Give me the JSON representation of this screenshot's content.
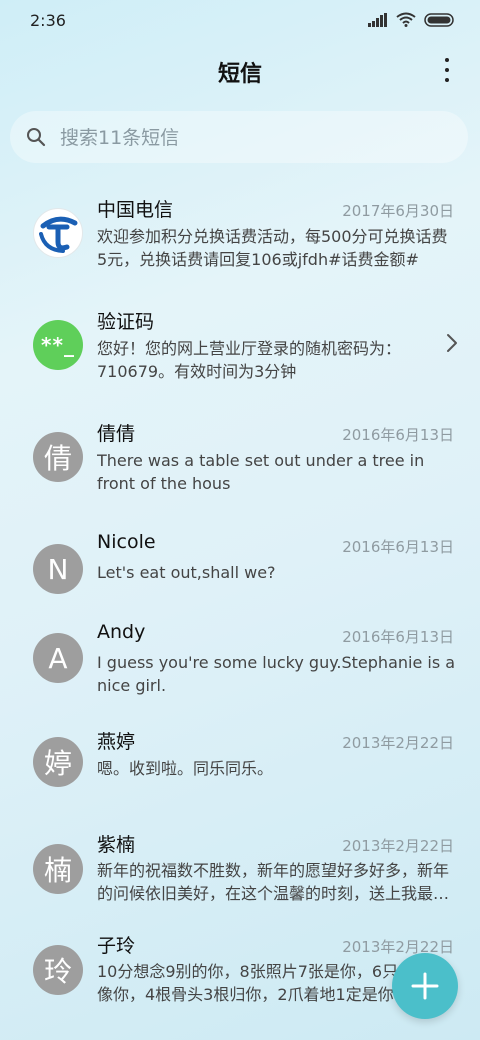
{
  "status_bar": {
    "time": "2:36",
    "icons": [
      "signal-icon",
      "wifi-icon",
      "battery-icon"
    ]
  },
  "header": {
    "title": "短信",
    "more_icon": "more-vertical-icon"
  },
  "search": {
    "placeholder": "搜索11条短信",
    "icon": "search-icon"
  },
  "conversations": [
    {
      "name": "中国电信",
      "date": "2017年6月30日",
      "preview": "欢迎参加积分兑换话费活动，每500分可兑换话费5元，兑换话费请回复106或jfdh#话费金额#",
      "avatar_icon": "china-telecom-logo-icon"
    },
    {
      "name": "验证码",
      "date": "",
      "preview": "您好！您的网上营业厅登录的随机密码为：710679。有效时间为3分钟",
      "avatar_text": "**_"
    },
    {
      "name": "倩倩",
      "date": "2016年6月13日",
      "preview": "There was a table set out under a tree in front of the hous",
      "avatar_text": "倩"
    },
    {
      "name": "Nicole",
      "date": "2016年6月13日",
      "preview": "Let's eat out,shall we?",
      "avatar_text": "N"
    },
    {
      "name": "Andy",
      "date": "2016年6月13日",
      "preview": "I guess you're some lucky guy.Stephanie is a nice girl.",
      "avatar_text": "A"
    },
    {
      "name": "燕婷",
      "date": "2013年2月22日",
      "preview": "嗯。收到啦。同乐同乐。",
      "avatar_text": "婷"
    },
    {
      "name": "紫楠",
      "date": "2013年2月22日",
      "preview": "新年的祝福数不胜数，新年的愿望好多好多，新年的问候依旧美好，在这个温馨的时刻，送上我最真挚的祝福",
      "avatar_text": "楠"
    },
    {
      "name": "子玲",
      "date": "2013年2月22日",
      "preview": "10分想念9别的你，8张照片7张是你，6只小狗只像你，4根骨头3根归你，2爪着地1定是你",
      "avatar_text": "玲"
    }
  ],
  "colors": {
    "accent": "#4bbfca",
    "avatar_gray": "#9e9e9e",
    "avatar_green": "#5fcf5a",
    "date": "#8f9ba1"
  },
  "fab": {
    "icon": "plus-icon"
  },
  "row_chevron_icon": "chevron-right-icon"
}
